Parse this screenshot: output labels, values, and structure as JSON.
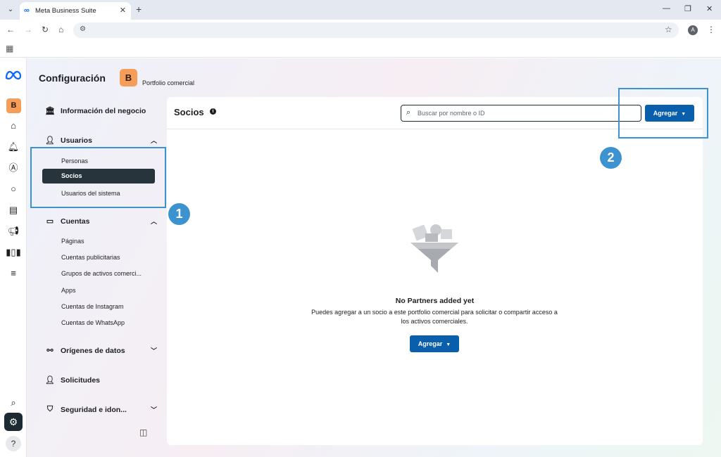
{
  "browser": {
    "tab_title": "Meta Business Suite",
    "tab_close": "✕",
    "new_tab": "+",
    "profile_initial": "A"
  },
  "rail": {
    "portfolio_initial": "B"
  },
  "header": {
    "title": "Configuración",
    "portfolio_initial": "B",
    "portfolio_name": "Portfolio comercial"
  },
  "sidebar": {
    "business_info": "Información del negocio",
    "users": {
      "label": "Usuarios",
      "items": [
        "Personas",
        "Socios",
        "Usuarios del sistema"
      ],
      "active": "Socios"
    },
    "accounts": {
      "label": "Cuentas",
      "items": [
        "Páginas",
        "Cuentas publicitarias",
        "Grupos de activos comerci...",
        "Apps",
        "Cuentas de Instagram",
        "Cuentas de WhatsApp"
      ]
    },
    "data_sources": "Orígenes de datos",
    "requests": "Solicitudes",
    "security": "Seguridad e idon..."
  },
  "main": {
    "title": "Socios",
    "search_placeholder": "Buscar por nombre o ID",
    "add_label": "Agregar",
    "empty_title": "No Partners added yet",
    "empty_desc": "Puedes agregar a un socio a este portfolio comercial para solicitar o compartir acceso a los activos comerciales.",
    "empty_add_label": "Agregar"
  },
  "annotations": {
    "step1": "1",
    "step2": "2",
    "color": "#3d92d0"
  },
  "colors": {
    "primary_button": "#0a5fad",
    "active_nav": "#28343c",
    "portfolio_badge": "#f59e5a",
    "meta_blue": "#0866ff"
  }
}
